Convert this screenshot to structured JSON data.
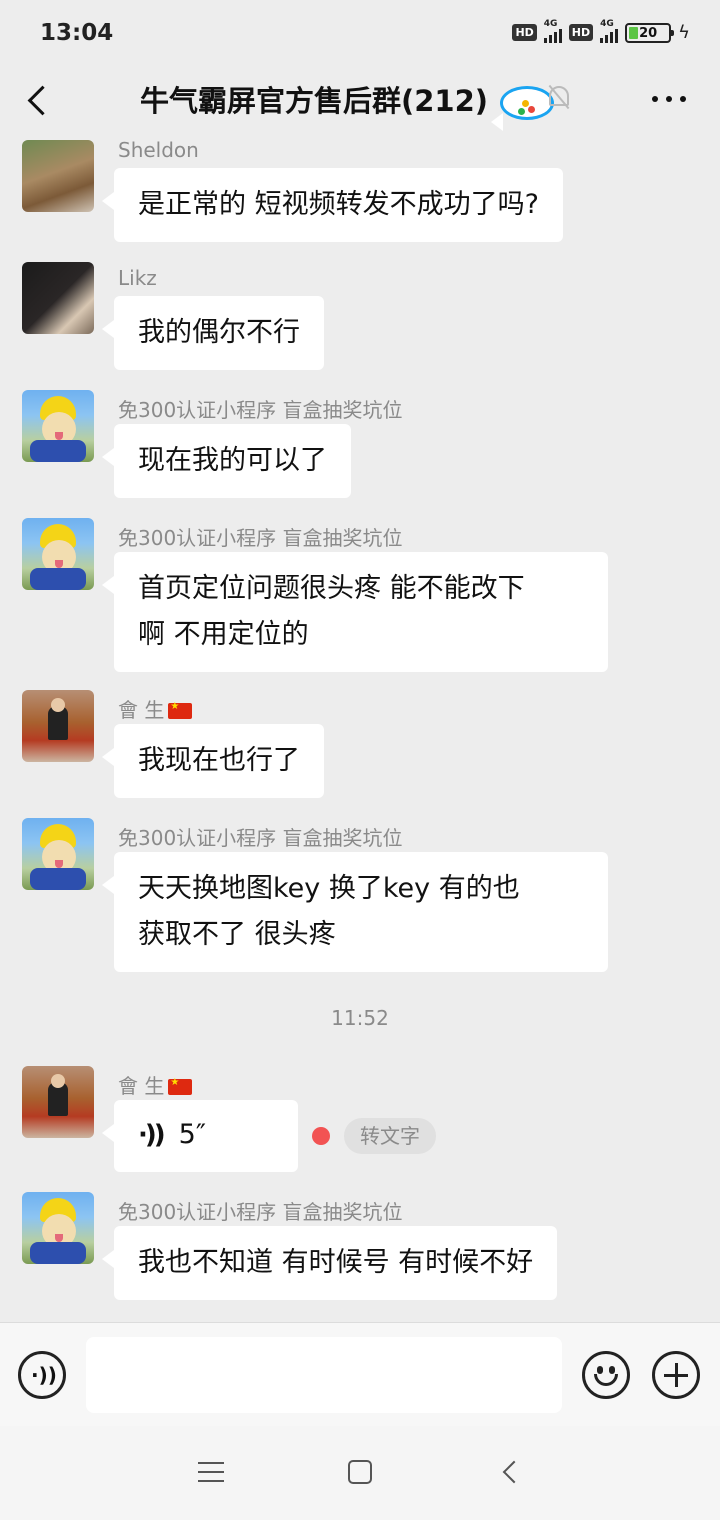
{
  "status_bar": {
    "time": "13:04",
    "hd1": "HD",
    "net1": "4G",
    "hd2": "HD",
    "net2": "4G",
    "battery_level": "20"
  },
  "header": {
    "title": "牛气霸屏官方售后群(212)",
    "icons": [
      "back-icon",
      "multi-chat-icon",
      "mute-icon",
      "more-icon"
    ]
  },
  "messages": [
    {
      "sender": "Sheldon",
      "text": "是正常的 短视频转发不成功了吗?"
    },
    {
      "sender": "Likz",
      "text": "我的偶尔不行"
    },
    {
      "sender": "免300认证小程序 盲盒抽奖坑位",
      "text": "现在我的可以了"
    },
    {
      "sender": "免300认证小程序 盲盒抽奖坑位",
      "line1": "首页定位问题很头疼 能不能改下",
      "line2": "啊  不用定位的"
    },
    {
      "sender": "會 生",
      "text": "我现在也行了"
    },
    {
      "sender": "免300认证小程序 盲盒抽奖坑位",
      "line1": "天天换地图key  换了key 有的也",
      "line2": "获取不了 很头疼"
    },
    {
      "time_separator": "11:52"
    },
    {
      "sender": "會 生",
      "voice_duration": "5″",
      "to_text_label": "转文字"
    },
    {
      "sender": "免300认证小程序 盲盒抽奖坑位",
      "text": "我也不知道 有时候号 有时候不好"
    }
  ],
  "input_bar": {
    "placeholder": "",
    "icons": [
      "voice-input-icon",
      "emoji-icon",
      "plus-icon"
    ]
  },
  "colors": {
    "background": "#ededed",
    "bubble": "#ffffff",
    "unread_dot": "#f25353",
    "battery_fill": "#5cc545"
  }
}
